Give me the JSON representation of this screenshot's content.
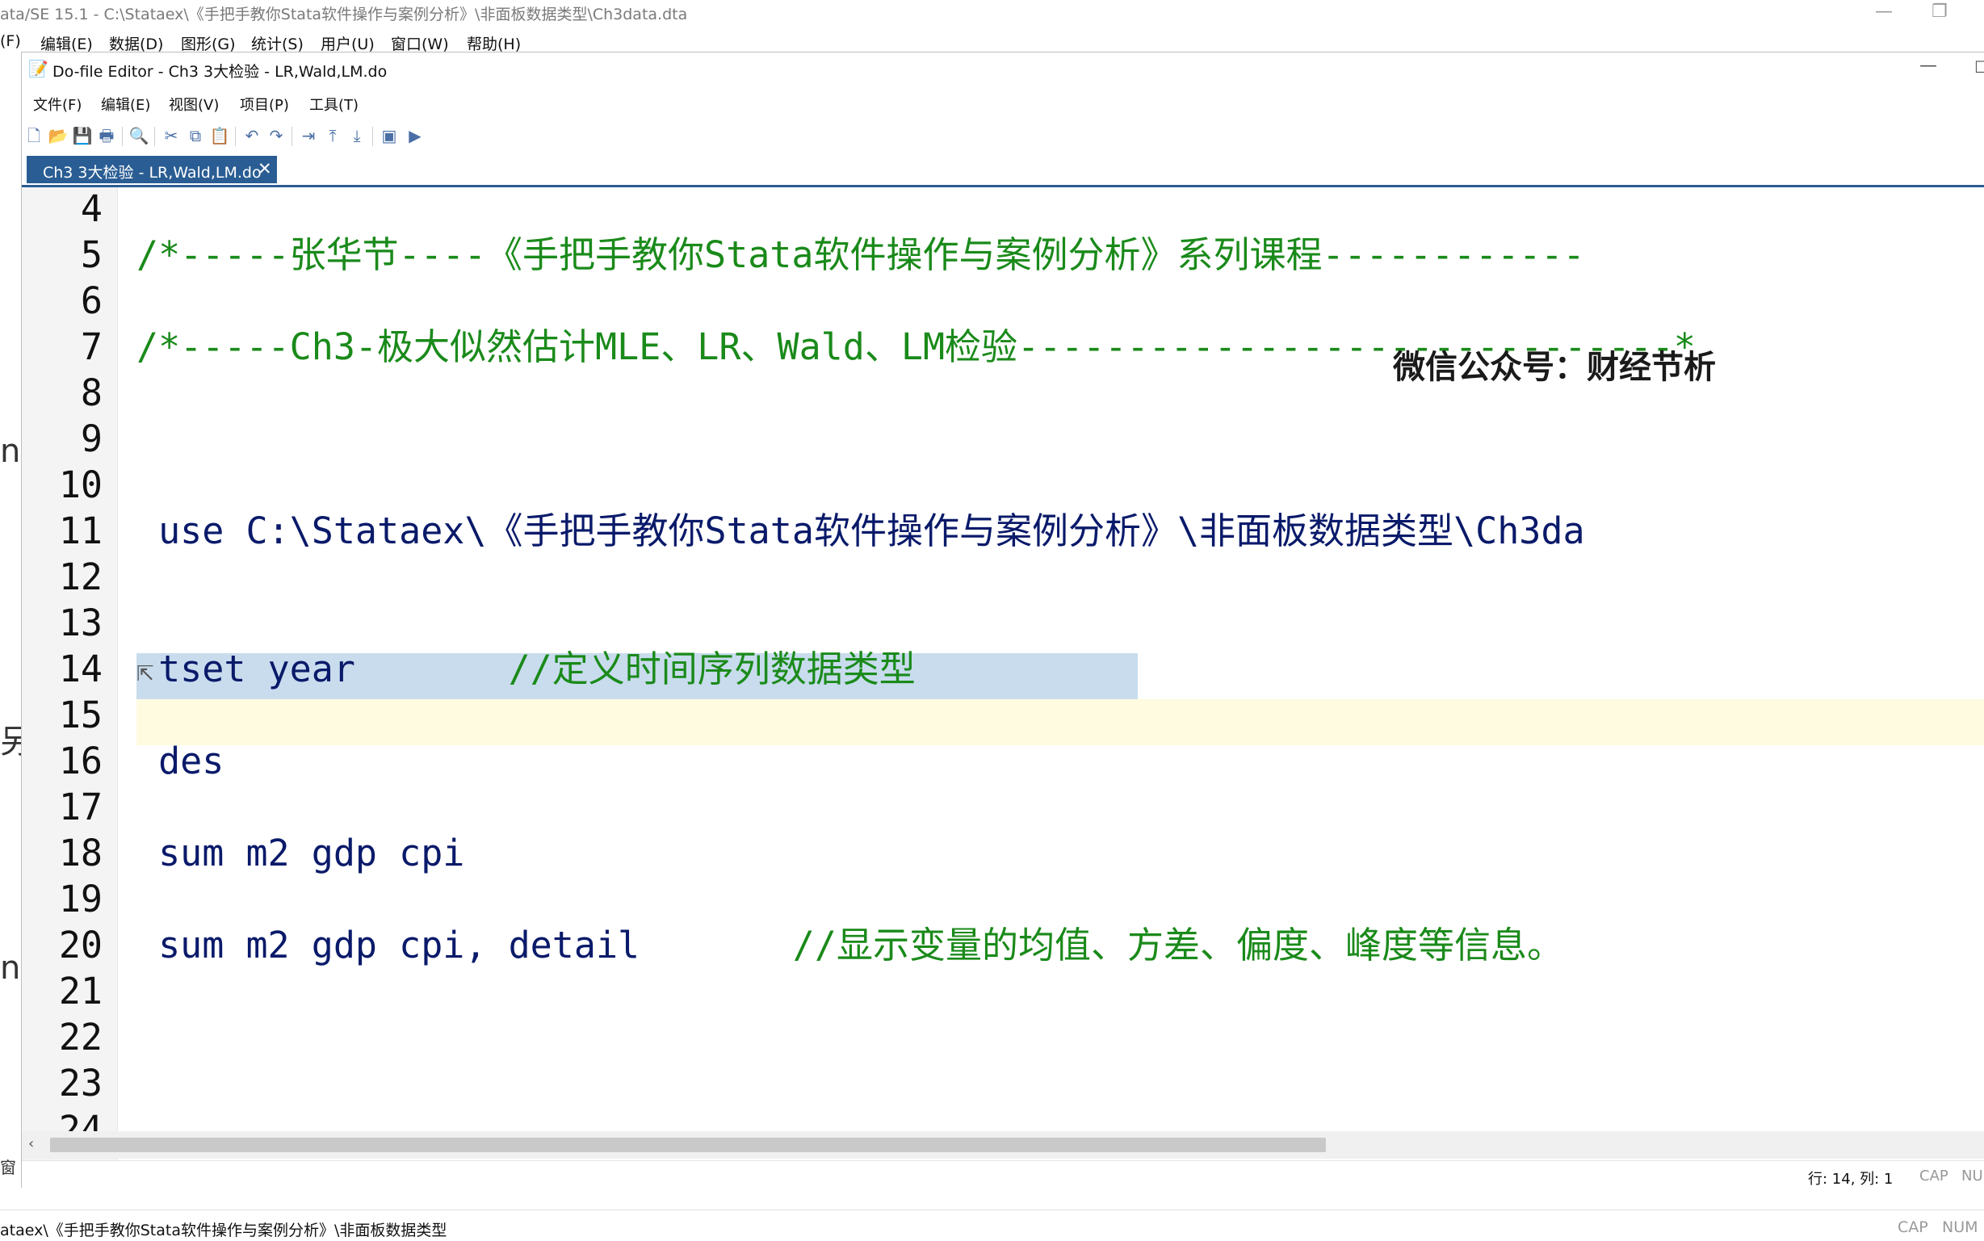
{
  "app": {
    "title": "ata/SE 15.1 - C:\\Stataex\\《手把手教你Stata软件操作与案例分析》\\非面板数据类型\\Ch3data.dta",
    "minimize": "—",
    "restore": "❐",
    "menu": [
      "(F)",
      "编辑(E)",
      "数据(D)",
      "图形(G)",
      "统计(S)",
      "用户(U)",
      "窗口(W)",
      "帮助(H)"
    ],
    "left_fragments": [
      "n",
      "另",
      "n",
      "窗"
    ],
    "status_path": "ataex\\《手把手教你Stata软件操作与案例分析》\\非面板数据类型",
    "status_caps": "CAP",
    "status_num": "NUM"
  },
  "editor": {
    "title": "Do-file Editor - Ch3 3大检验 - LR,Wald,LM.do",
    "minimize": "—",
    "maximize": "☐",
    "menu": [
      "文件(F)",
      "编辑(E)",
      "视图(V)",
      "项目(P)",
      "工具(T)"
    ],
    "toolbar_icons": [
      {
        "name": "new-file-icon",
        "glyph": "🗋"
      },
      {
        "name": "open-folder-icon",
        "glyph": "📂"
      },
      {
        "name": "save-icon",
        "glyph": "💾"
      },
      {
        "name": "print-icon",
        "glyph": "🖶"
      },
      {
        "name": "find-icon",
        "glyph": "🔍"
      },
      {
        "name": "cut-icon",
        "glyph": "✂"
      },
      {
        "name": "copy-icon",
        "glyph": "⧉"
      },
      {
        "name": "paste-icon",
        "glyph": "📋"
      },
      {
        "name": "undo-icon",
        "glyph": "↶"
      },
      {
        "name": "redo-icon",
        "glyph": "↷"
      },
      {
        "name": "indent-icon",
        "glyph": "⇥"
      },
      {
        "name": "move-top-icon",
        "glyph": "⤒"
      },
      {
        "name": "move-bottom-icon",
        "glyph": "⤓"
      },
      {
        "name": "show-icon",
        "glyph": "▣"
      },
      {
        "name": "execute-icon",
        "glyph": "▶"
      }
    ],
    "tab": {
      "label": "Ch3 3大检验 - LR,Wald,LM.do",
      "close": "✕"
    },
    "lines": [
      {
        "n": "4",
        "text": ""
      },
      {
        "n": "5",
        "text": "/*-----张华节----《手把手教你Stata软件操作与案例分析》系列课程------------"
      },
      {
        "n": "6",
        "text": ""
      },
      {
        "n": "7",
        "text": "/*-----Ch3-极大似然估计MLE、LR、Wald、LM检验------------------------------*"
      },
      {
        "n": "8",
        "text": ""
      },
      {
        "n": "9",
        "text": ""
      },
      {
        "n": "10",
        "text": ""
      },
      {
        "n": "11",
        "text": " use C:\\Stataex\\《手把手教你Stata软件操作与案例分析》\\非面板数据类型\\Ch3da"
      },
      {
        "n": "12",
        "text": ""
      },
      {
        "n": "13",
        "code": " tset year       ",
        "comment": "//定义时间序列数据类型"
      },
      {
        "n": "14",
        "text": ""
      },
      {
        "n": "15",
        "text": " des"
      },
      {
        "n": "16",
        "text": ""
      },
      {
        "n": "17",
        "text": " sum m2 gdp cpi"
      },
      {
        "n": "18",
        "text": ""
      },
      {
        "n": "19",
        "code": " sum m2 gdp cpi, detail       ",
        "comment": "//显示变量的均值、方差、偏度、峰度等信息。"
      },
      {
        "n": "20",
        "text": ""
      },
      {
        "n": "21",
        "text": ""
      },
      {
        "n": "22",
        "text": ""
      },
      {
        "n": "23",
        "text": ""
      },
      {
        "n": "24",
        "text": ""
      }
    ],
    "watermark": "微信公众号：财经节析",
    "status": {
      "position": "行: 14, 列: 1",
      "caps": "CAP",
      "num": "NU"
    }
  },
  "colors": {
    "tab_active": "#2a5d93",
    "comment": "#1a8a1a",
    "keyword": "#0a1a6a",
    "selection": "#c8dced",
    "current_line": "#fffbe0"
  }
}
